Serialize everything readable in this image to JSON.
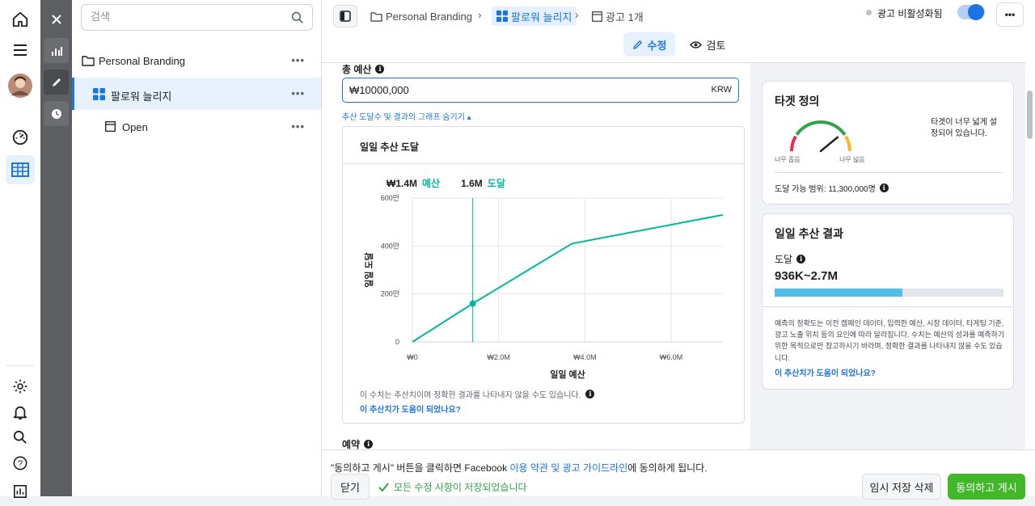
{
  "colors": {
    "accent": "#1b74e4",
    "series": "#00b89c",
    "fill_bar": "#4cc0e8",
    "ok": "#31a24c",
    "gauge_red": "#f02849",
    "gauge_green": "#31a24c",
    "gauge_orange": "#f7b928"
  },
  "search": {
    "placeholder": "검색",
    "icon": "search-icon"
  },
  "tree": {
    "campaign": {
      "label": "Personal Branding",
      "icon": "folder-icon",
      "more": "•••"
    },
    "adset": {
      "label": "팔로워 늘리지",
      "icon": "adset-grid-icon",
      "more": "•••"
    },
    "ad": {
      "label": "Open",
      "icon": "ad-frame-icon",
      "more": "•••"
    }
  },
  "breadcrumb": {
    "campaign": "Personal Branding",
    "adset": "팔로워 늘리지",
    "ad": "광고 1개"
  },
  "header": {
    "status_label": "광고 비활성화됨",
    "toggle_on": true,
    "more": "•••"
  },
  "view_tabs": {
    "edit": "수정",
    "review": "검토"
  },
  "budget": {
    "label": "총 예산",
    "value": "₩10000,000",
    "currency": "KRW",
    "toggle_graph": "추산 도달수 및 결과의 그래프 숨기기 ▴"
  },
  "reach_card": {
    "title": "일일 추산 도달",
    "budget_value": "₩1.4M",
    "budget_label": "예산",
    "reach_value": "1.6M",
    "reach_label": "도달",
    "disclaimer": "이 수치는 추산치이며 정확한 결과를 나타내지 않을 수도 있습니다.",
    "help_link": "이 추산치가 도움이 되었나요?"
  },
  "chart_data": {
    "type": "line",
    "xlabel": "일일 예산",
    "ylabel": "일일 도달",
    "x_ticks": [
      {
        "v": 0,
        "label": "₩0"
      },
      {
        "v": 2.0,
        "label": "₩2.0M"
      },
      {
        "v": 4.0,
        "label": "₩4.0M"
      },
      {
        "v": 6.0,
        "label": "₩6.0M"
      }
    ],
    "y_ticks": [
      {
        "v": 0,
        "label": "0"
      },
      {
        "v": 200,
        "label": "200만"
      },
      {
        "v": 400,
        "label": "400만"
      },
      {
        "v": 600,
        "label": "600만"
      }
    ],
    "xlim": [
      0,
      7.2
    ],
    "ylim": [
      0,
      600
    ],
    "series": [
      {
        "x": [
          0,
          1.4,
          3.7,
          7.2
        ],
        "y": [
          0,
          160,
          410,
          530
        ]
      }
    ],
    "marker": {
      "x": 1.4,
      "y": 160
    },
    "grid": true
  },
  "schedule": {
    "label": "예약"
  },
  "target_card": {
    "title": "타겟 정의",
    "gauge_left": "너무 좁음",
    "gauge_right": "너무 넓음",
    "gauge_level": 0.78,
    "description": "타겟이 너무 넓게 설정되어 있습니다.",
    "potential": "도달 가능 범위: 11,300,000명"
  },
  "results_card": {
    "title": "일일 추산 결과",
    "metric_label": "도달",
    "metric_value": "936K~2.7M",
    "fill_fraction": 0.56,
    "note": "예측의 정확도는 이전 캠페인 데이터, 입력한 예산, 시장 데이터, 타게팅 기준, 광고 노출 위치 등의 요인에 따라 달라집니다. 수치는 예산의 성과를 예측하기 위한 목적으로만 참고하시기 바라며, 정확한 결과를 나타내지 않을 수도 있습니다.",
    "help_link": "이 추산치가 도움이 되었나요?"
  },
  "footer": {
    "terms_prefix": "\"동의하고 게시\" 버튼을 클릭하면 Facebook ",
    "terms_link": "이용 약관 및 광고 가이드라인",
    "terms_suffix": "에 동의하게 됩니다.",
    "close": "닫기",
    "saved": "모든 수정 사항이 저장되었습니다",
    "discard": "임시 저장 삭제",
    "publish": "동의하고 게시"
  }
}
